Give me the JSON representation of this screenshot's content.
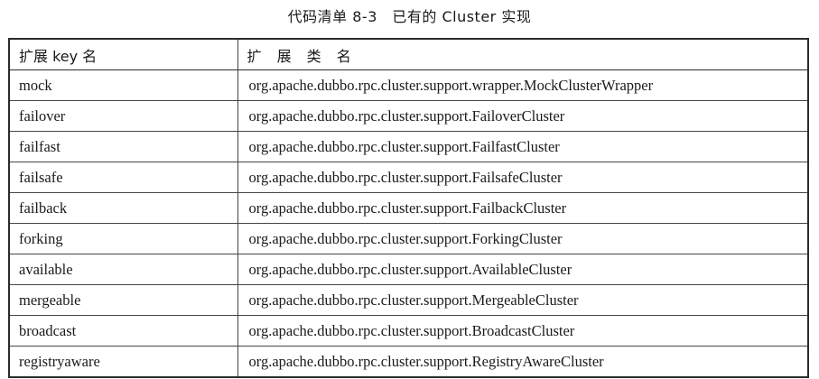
{
  "caption": "代码清单 8-3　已有的 Cluster 实现",
  "table": {
    "headers": [
      "扩展 key 名",
      "扩 展 类 名"
    ],
    "rows": [
      [
        "mock",
        "org.apache.dubbo.rpc.cluster.support.wrapper.MockClusterWrapper"
      ],
      [
        "failover",
        "org.apache.dubbo.rpc.cluster.support.FailoverCluster"
      ],
      [
        "failfast",
        "org.apache.dubbo.rpc.cluster.support.FailfastCluster"
      ],
      [
        "failsafe",
        "org.apache.dubbo.rpc.cluster.support.FailsafeCluster"
      ],
      [
        "failback",
        "org.apache.dubbo.rpc.cluster.support.FailbackCluster"
      ],
      [
        "forking",
        "org.apache.dubbo.rpc.cluster.support.ForkingCluster"
      ],
      [
        "available",
        "org.apache.dubbo.rpc.cluster.support.AvailableCluster"
      ],
      [
        "mergeable",
        "org.apache.dubbo.rpc.cluster.support.MergeableCluster"
      ],
      [
        "broadcast",
        "org.apache.dubbo.rpc.cluster.support.BroadcastCluster"
      ],
      [
        "registryaware",
        "org.apache.dubbo.rpc.cluster.support.RegistryAwareCluster"
      ]
    ]
  }
}
